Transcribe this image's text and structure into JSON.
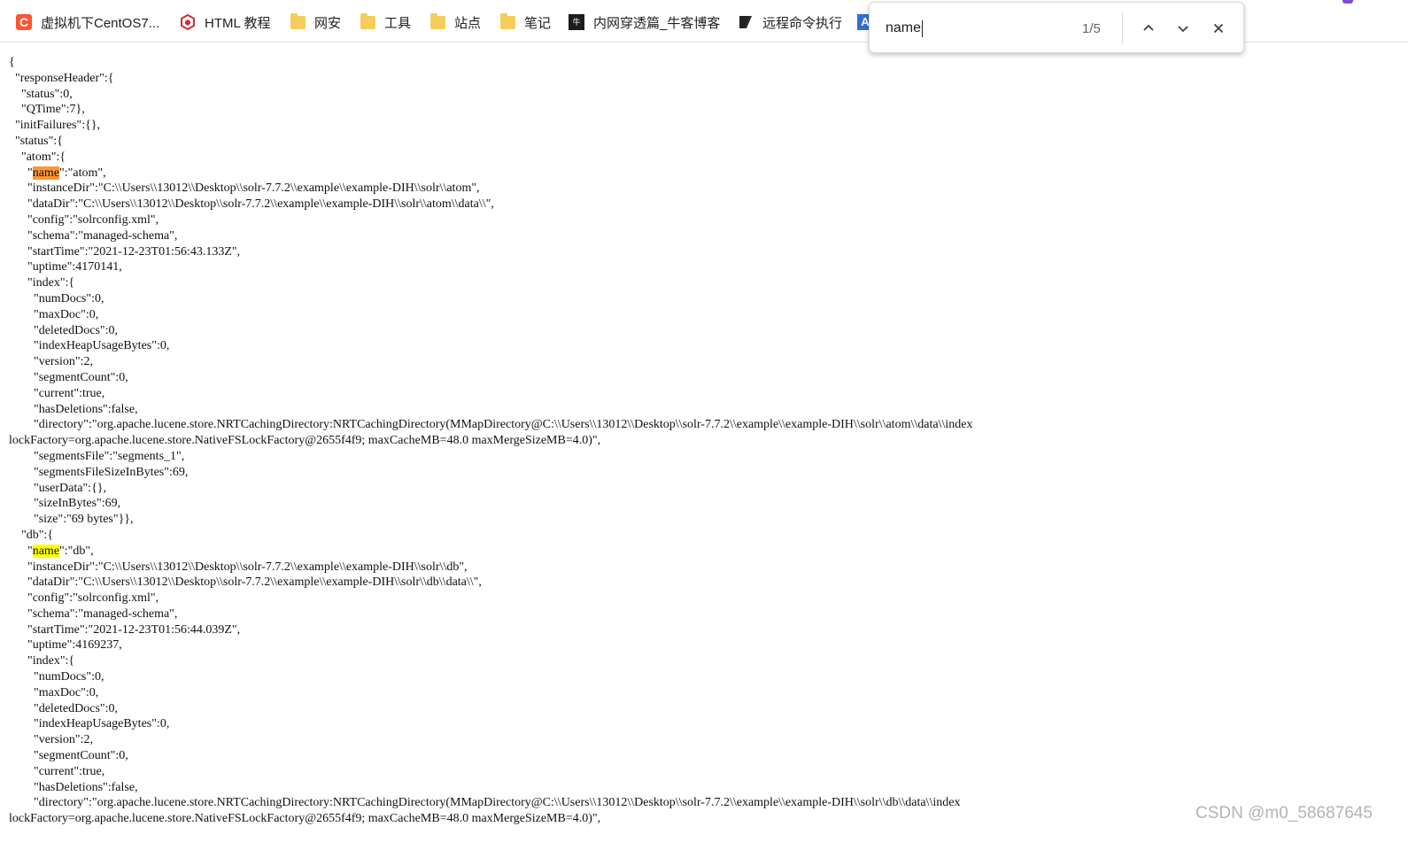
{
  "bookmarks": [
    {
      "label": "虚拟机下CentOS7...",
      "icon": "csdn-icon"
    },
    {
      "label": "HTML 教程",
      "icon": "html-icon"
    },
    {
      "label": "网安",
      "icon": "folder-icon"
    },
    {
      "label": "工具",
      "icon": "folder-icon"
    },
    {
      "label": "站点",
      "icon": "folder-icon"
    },
    {
      "label": "笔记",
      "icon": "folder-icon"
    },
    {
      "label": "内网穿透篇_牛客博客",
      "icon": "nowcoder-icon"
    },
    {
      "label": "远程命令执行",
      "icon": "bookmark-page-icon"
    }
  ],
  "find": {
    "query": "name",
    "count": "1/5"
  },
  "lines": [
    {
      "pre": "{",
      "mark": "",
      "post": "",
      "hl": ""
    },
    {
      "pre": "  \"responseHeader\":{",
      "mark": "",
      "post": "",
      "hl": ""
    },
    {
      "pre": "    \"status\":0,",
      "mark": "",
      "post": "",
      "hl": ""
    },
    {
      "pre": "    \"QTime\":7},",
      "mark": "",
      "post": "",
      "hl": ""
    },
    {
      "pre": "  \"initFailures\":{},",
      "mark": "",
      "post": "",
      "hl": ""
    },
    {
      "pre": "  \"status\":{",
      "mark": "",
      "post": "",
      "hl": ""
    },
    {
      "pre": "    \"atom\":{",
      "mark": "",
      "post": "",
      "hl": ""
    },
    {
      "pre": "      \"",
      "mark": "name",
      "post": "\":\"atom\",",
      "hl": "active"
    },
    {
      "pre": "      \"instanceDir\":\"C:\\\\Users\\\\13012\\\\Desktop\\\\solr-7.7.2\\\\example\\\\example-DIH\\\\solr\\\\atom\",",
      "mark": "",
      "post": "",
      "hl": ""
    },
    {
      "pre": "      \"dataDir\":\"C:\\\\Users\\\\13012\\\\Desktop\\\\solr-7.7.2\\\\example\\\\example-DIH\\\\solr\\\\atom\\\\data\\\\\",",
      "mark": "",
      "post": "",
      "hl": ""
    },
    {
      "pre": "      \"config\":\"solrconfig.xml\",",
      "mark": "",
      "post": "",
      "hl": ""
    },
    {
      "pre": "      \"schema\":\"managed-schema\",",
      "mark": "",
      "post": "",
      "hl": ""
    },
    {
      "pre": "      \"startTime\":\"2021-12-23T01:56:43.133Z\",",
      "mark": "",
      "post": "",
      "hl": ""
    },
    {
      "pre": "      \"uptime\":4170141,",
      "mark": "",
      "post": "",
      "hl": ""
    },
    {
      "pre": "      \"index\":{",
      "mark": "",
      "post": "",
      "hl": ""
    },
    {
      "pre": "        \"numDocs\":0,",
      "mark": "",
      "post": "",
      "hl": ""
    },
    {
      "pre": "        \"maxDoc\":0,",
      "mark": "",
      "post": "",
      "hl": ""
    },
    {
      "pre": "        \"deletedDocs\":0,",
      "mark": "",
      "post": "",
      "hl": ""
    },
    {
      "pre": "        \"indexHeapUsageBytes\":0,",
      "mark": "",
      "post": "",
      "hl": ""
    },
    {
      "pre": "        \"version\":2,",
      "mark": "",
      "post": "",
      "hl": ""
    },
    {
      "pre": "        \"segmentCount\":0,",
      "mark": "",
      "post": "",
      "hl": ""
    },
    {
      "pre": "        \"current\":true,",
      "mark": "",
      "post": "",
      "hl": ""
    },
    {
      "pre": "        \"hasDeletions\":false,",
      "mark": "",
      "post": "",
      "hl": ""
    },
    {
      "pre": "        \"directory\":\"org.apache.lucene.store.NRTCachingDirectory:NRTCachingDirectory(MMapDirectory@C:\\\\Users\\\\13012\\\\Desktop\\\\solr-7.7.2\\\\example\\\\example-DIH\\\\solr\\\\atom\\\\data\\\\index",
      "mark": "",
      "post": "",
      "hl": ""
    },
    {
      "pre": "lockFactory=org.apache.lucene.store.NativeFSLockFactory@2655f4f9; maxCacheMB=48.0 maxMergeSizeMB=4.0)\",",
      "mark": "",
      "post": "",
      "hl": ""
    },
    {
      "pre": "        \"segmentsFile\":\"segments_1\",",
      "mark": "",
      "post": "",
      "hl": ""
    },
    {
      "pre": "        \"segmentsFileSizeInBytes\":69,",
      "mark": "",
      "post": "",
      "hl": ""
    },
    {
      "pre": "        \"userData\":{},",
      "mark": "",
      "post": "",
      "hl": ""
    },
    {
      "pre": "        \"sizeInBytes\":69,",
      "mark": "",
      "post": "",
      "hl": ""
    },
    {
      "pre": "        \"size\":\"69 bytes\"}},",
      "mark": "",
      "post": "",
      "hl": ""
    },
    {
      "pre": "    \"db\":{",
      "mark": "",
      "post": "",
      "hl": ""
    },
    {
      "pre": "      \"",
      "mark": "name",
      "post": "\":\"db\",",
      "hl": "match"
    },
    {
      "pre": "      \"instanceDir\":\"C:\\\\Users\\\\13012\\\\Desktop\\\\solr-7.7.2\\\\example\\\\example-DIH\\\\solr\\\\db\",",
      "mark": "",
      "post": "",
      "hl": ""
    },
    {
      "pre": "      \"dataDir\":\"C:\\\\Users\\\\13012\\\\Desktop\\\\solr-7.7.2\\\\example\\\\example-DIH\\\\solr\\\\db\\\\data\\\\\",",
      "mark": "",
      "post": "",
      "hl": ""
    },
    {
      "pre": "      \"config\":\"solrconfig.xml\",",
      "mark": "",
      "post": "",
      "hl": ""
    },
    {
      "pre": "      \"schema\":\"managed-schema\",",
      "mark": "",
      "post": "",
      "hl": ""
    },
    {
      "pre": "      \"startTime\":\"2021-12-23T01:56:44.039Z\",",
      "mark": "",
      "post": "",
      "hl": ""
    },
    {
      "pre": "      \"uptime\":4169237,",
      "mark": "",
      "post": "",
      "hl": ""
    },
    {
      "pre": "      \"index\":{",
      "mark": "",
      "post": "",
      "hl": ""
    },
    {
      "pre": "        \"numDocs\":0,",
      "mark": "",
      "post": "",
      "hl": ""
    },
    {
      "pre": "        \"maxDoc\":0,",
      "mark": "",
      "post": "",
      "hl": ""
    },
    {
      "pre": "        \"deletedDocs\":0,",
      "mark": "",
      "post": "",
      "hl": ""
    },
    {
      "pre": "        \"indexHeapUsageBytes\":0,",
      "mark": "",
      "post": "",
      "hl": ""
    },
    {
      "pre": "        \"version\":2,",
      "mark": "",
      "post": "",
      "hl": ""
    },
    {
      "pre": "        \"segmentCount\":0,",
      "mark": "",
      "post": "",
      "hl": ""
    },
    {
      "pre": "        \"current\":true,",
      "mark": "",
      "post": "",
      "hl": ""
    },
    {
      "pre": "        \"hasDeletions\":false,",
      "mark": "",
      "post": "",
      "hl": ""
    },
    {
      "pre": "        \"directory\":\"org.apache.lucene.store.NRTCachingDirectory:NRTCachingDirectory(MMapDirectory@C:\\\\Users\\\\13012\\\\Desktop\\\\solr-7.7.2\\\\example\\\\example-DIH\\\\solr\\\\db\\\\data\\\\index",
      "mark": "",
      "post": "",
      "hl": ""
    },
    {
      "pre": "lockFactory=org.apache.lucene.store.NativeFSLockFactory@2655f4f9; maxCacheMB=48.0 maxMergeSizeMB=4.0)\",",
      "mark": "",
      "post": "",
      "hl": ""
    }
  ],
  "watermark": "CSDN @m0_58687645",
  "colors": {
    "active_match": "#ff9632",
    "match": "#ffff00"
  }
}
